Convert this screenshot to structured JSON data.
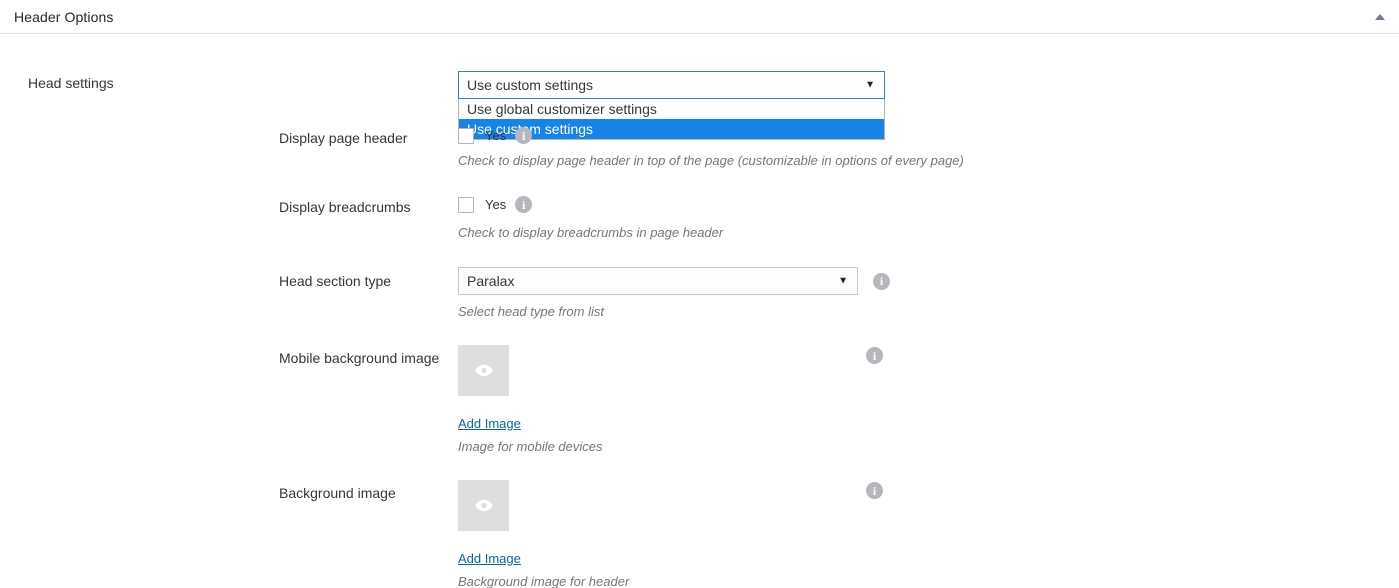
{
  "panel": {
    "title": "Header Options",
    "collapse_icon": "chevron-up-icon"
  },
  "section": {
    "label": "Head settings"
  },
  "head_settings_select": {
    "value": "Use custom settings",
    "arrow_icon": "chevron-down-icon",
    "options": [
      "Use global customizer settings",
      "Use custom settings"
    ],
    "selected_index": 1
  },
  "fields": [
    {
      "label": "Display page header",
      "control": "checkbox",
      "checkbox_label": "Yes",
      "checked": false,
      "info_icon": "info-icon",
      "description": "Check to display page header in top of the page (customizable in options of every page)"
    },
    {
      "label": "Display breadcrumbs",
      "control": "checkbox",
      "checkbox_label": "Yes",
      "checked": false,
      "info_icon": "info-icon",
      "description": "Check to display breadcrumbs in page header"
    },
    {
      "label": "Head section type",
      "control": "select",
      "value": "Paralax",
      "arrow_icon": "chevron-down-icon",
      "info_icon": "info-icon",
      "description": "Select head type from list"
    },
    {
      "label": "Mobile background image",
      "control": "image",
      "placeholder_icon": "eye-icon",
      "add_label": "Add Image",
      "info_icon": "info-icon",
      "description": "Image for mobile devices"
    },
    {
      "label": "Background image",
      "control": "image",
      "placeholder_icon": "eye-icon",
      "add_label": "Add Image",
      "info_icon": "info-icon",
      "description": "Background image for header"
    }
  ],
  "colors": {
    "highlight": "#1583e8",
    "focus_border": "#2f7fd1",
    "link": "#0b66a3",
    "text": "#32373c",
    "muted": "#72777c"
  }
}
